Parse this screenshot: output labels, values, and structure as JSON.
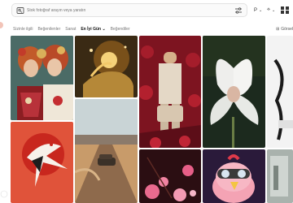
{
  "search": {
    "placeholder": "Stok fotoğraf arayın veya yaratın"
  },
  "toolbar": {
    "type_label": "P",
    "ai_label": "⟡"
  },
  "nav": {
    "items": [
      "Sizinle ilgili",
      "Beğenilenler",
      "Sanat",
      "En İyi Gün",
      "Beğendiler"
    ],
    "active_index": 3,
    "generate_label": "Görsel"
  },
  "gallery": {
    "tiles": [
      {
        "name": "tile-folk-portrait",
        "subject": "two women in traditional headdresses"
      },
      {
        "name": "tile-golden-hands",
        "subject": "glowing golden hands"
      },
      {
        "name": "tile-roses-fashion",
        "subject": "man in suit among red roses"
      },
      {
        "name": "tile-white-flower",
        "subject": "white lily with figure"
      },
      {
        "name": "tile-red-sun-bird",
        "subject": "crane over red sun"
      },
      {
        "name": "tile-desert-car",
        "subject": "car on desert road"
      },
      {
        "name": "tile-pink-blossoms",
        "subject": "pink blossoms"
      },
      {
        "name": "tile-cartoon-chicken",
        "subject": "3d character with goggles"
      },
      {
        "name": "tile-edge-white",
        "subject": "white abstract"
      }
    ]
  },
  "colors": {
    "accent": "#e0335a",
    "active_nav": "#111111"
  }
}
